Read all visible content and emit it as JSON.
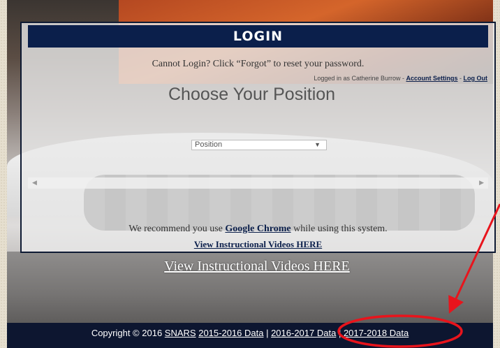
{
  "card": {
    "title": "LOGIN",
    "forgot_text": "Cannot Login? Click “Forgot” to reset your password.",
    "logged_in_prefix": "Logged in as Catherine Burrow - ",
    "account_settings": "Account Settings",
    "separator": " - ",
    "log_out": "Log Out",
    "choose_heading": "Choose Your Position",
    "position_select": {
      "selected": "Position",
      "arrow": "▼"
    },
    "scroll_left": "◀",
    "scroll_right": "▶",
    "recommend_prefix": "We recommend you use ",
    "recommend_link": "Google Chrome",
    "recommend_suffix": " while using this system.",
    "videos_link": "View Instructional Videos HERE"
  },
  "outer_videos_link": "View Instructional Videos HERE",
  "footer": {
    "copyright_prefix": "Copyright © 2016 ",
    "links": [
      "SNARS",
      "2015-2016 Data",
      "2016-2017 Data",
      "2017-2018 Data"
    ],
    "sep": " | "
  },
  "colors": {
    "header_bg": "#0b1f4b",
    "footer_bg": "#0d1630",
    "annotation": "#e8141c"
  },
  "icons": {
    "select_arrow": "chevron-down-icon",
    "annotation_arrow": "arrow-icon",
    "annotation_circle": "highlight-circle-icon"
  }
}
